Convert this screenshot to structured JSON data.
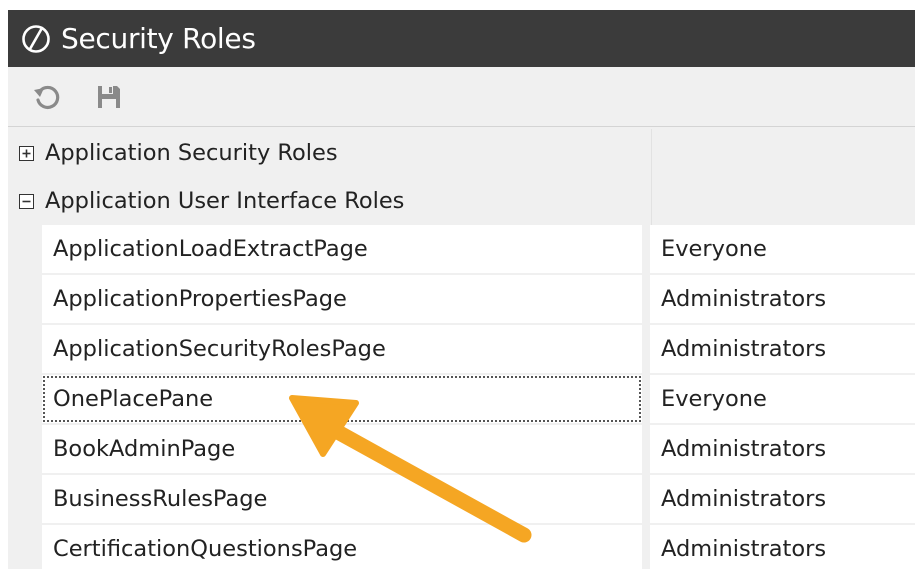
{
  "window": {
    "title": "Security Roles",
    "logo_icon": "onestream-logo-icon"
  },
  "toolbar": {
    "buttons": [
      {
        "icon": "refresh-icon"
      },
      {
        "icon": "save-icon"
      }
    ]
  },
  "groups": [
    {
      "label": "Application Security Roles",
      "state": "collapsed"
    },
    {
      "label": "Application User Interface Roles",
      "state": "expanded"
    }
  ],
  "rows": [
    {
      "name": "ApplicationLoadExtractPage",
      "role": "Everyone"
    },
    {
      "name": "ApplicationPropertiesPage",
      "role": "Administrators"
    },
    {
      "name": "ApplicationSecurityRolesPage",
      "role": "Administrators"
    },
    {
      "name": "OnePlacePane",
      "role": "Everyone",
      "focused": true
    },
    {
      "name": "BookAdminPage",
      "role": "Administrators"
    },
    {
      "name": "BusinessRulesPage",
      "role": "Administrators"
    },
    {
      "name": "CertificationQuestionsPage",
      "role": "Administrators"
    }
  ],
  "colors": {
    "titlebar": "#3b3b3b",
    "toolbar": "#f0f0f0",
    "arrow": "#f5a623"
  }
}
